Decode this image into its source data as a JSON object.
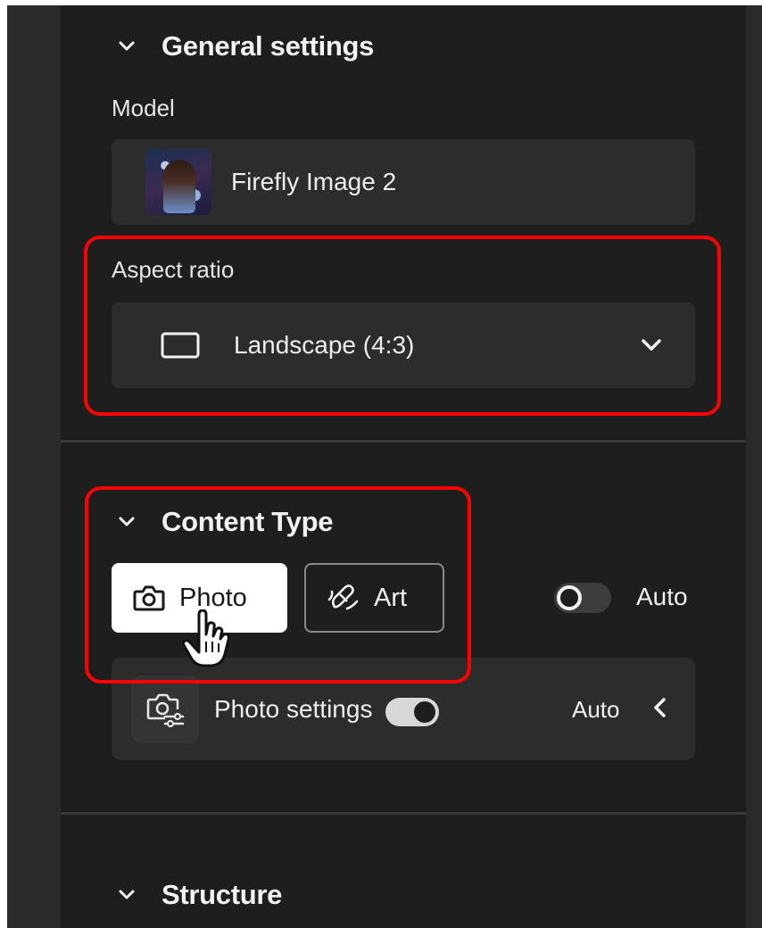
{
  "general_settings": {
    "title": "General settings",
    "model_label": "Model",
    "model_name": "Firefly Image 2",
    "aspect_label": "Aspect ratio",
    "aspect_value": "Landscape (4:3)"
  },
  "content_type": {
    "title": "Content Type",
    "photo_label": "Photo",
    "art_label": "Art",
    "auto_toggle_label": "Auto",
    "auto_toggle_on": false
  },
  "photo_settings": {
    "label": "Photo settings",
    "auto_label": "Auto",
    "auto_toggle_on": true
  },
  "structure": {
    "title": "Structure"
  },
  "colors": {
    "panel_bg": "#1e1e1e",
    "control_bg": "#2c2c2c",
    "highlight": "#ff0000",
    "selected_button": "#ffffff"
  },
  "icons": [
    "chevron-down-icon",
    "landscape-frame-icon",
    "camera-icon",
    "art-brush-icon",
    "photo-settings-icon",
    "chevron-left-icon",
    "hand-pointer-cursor"
  ]
}
